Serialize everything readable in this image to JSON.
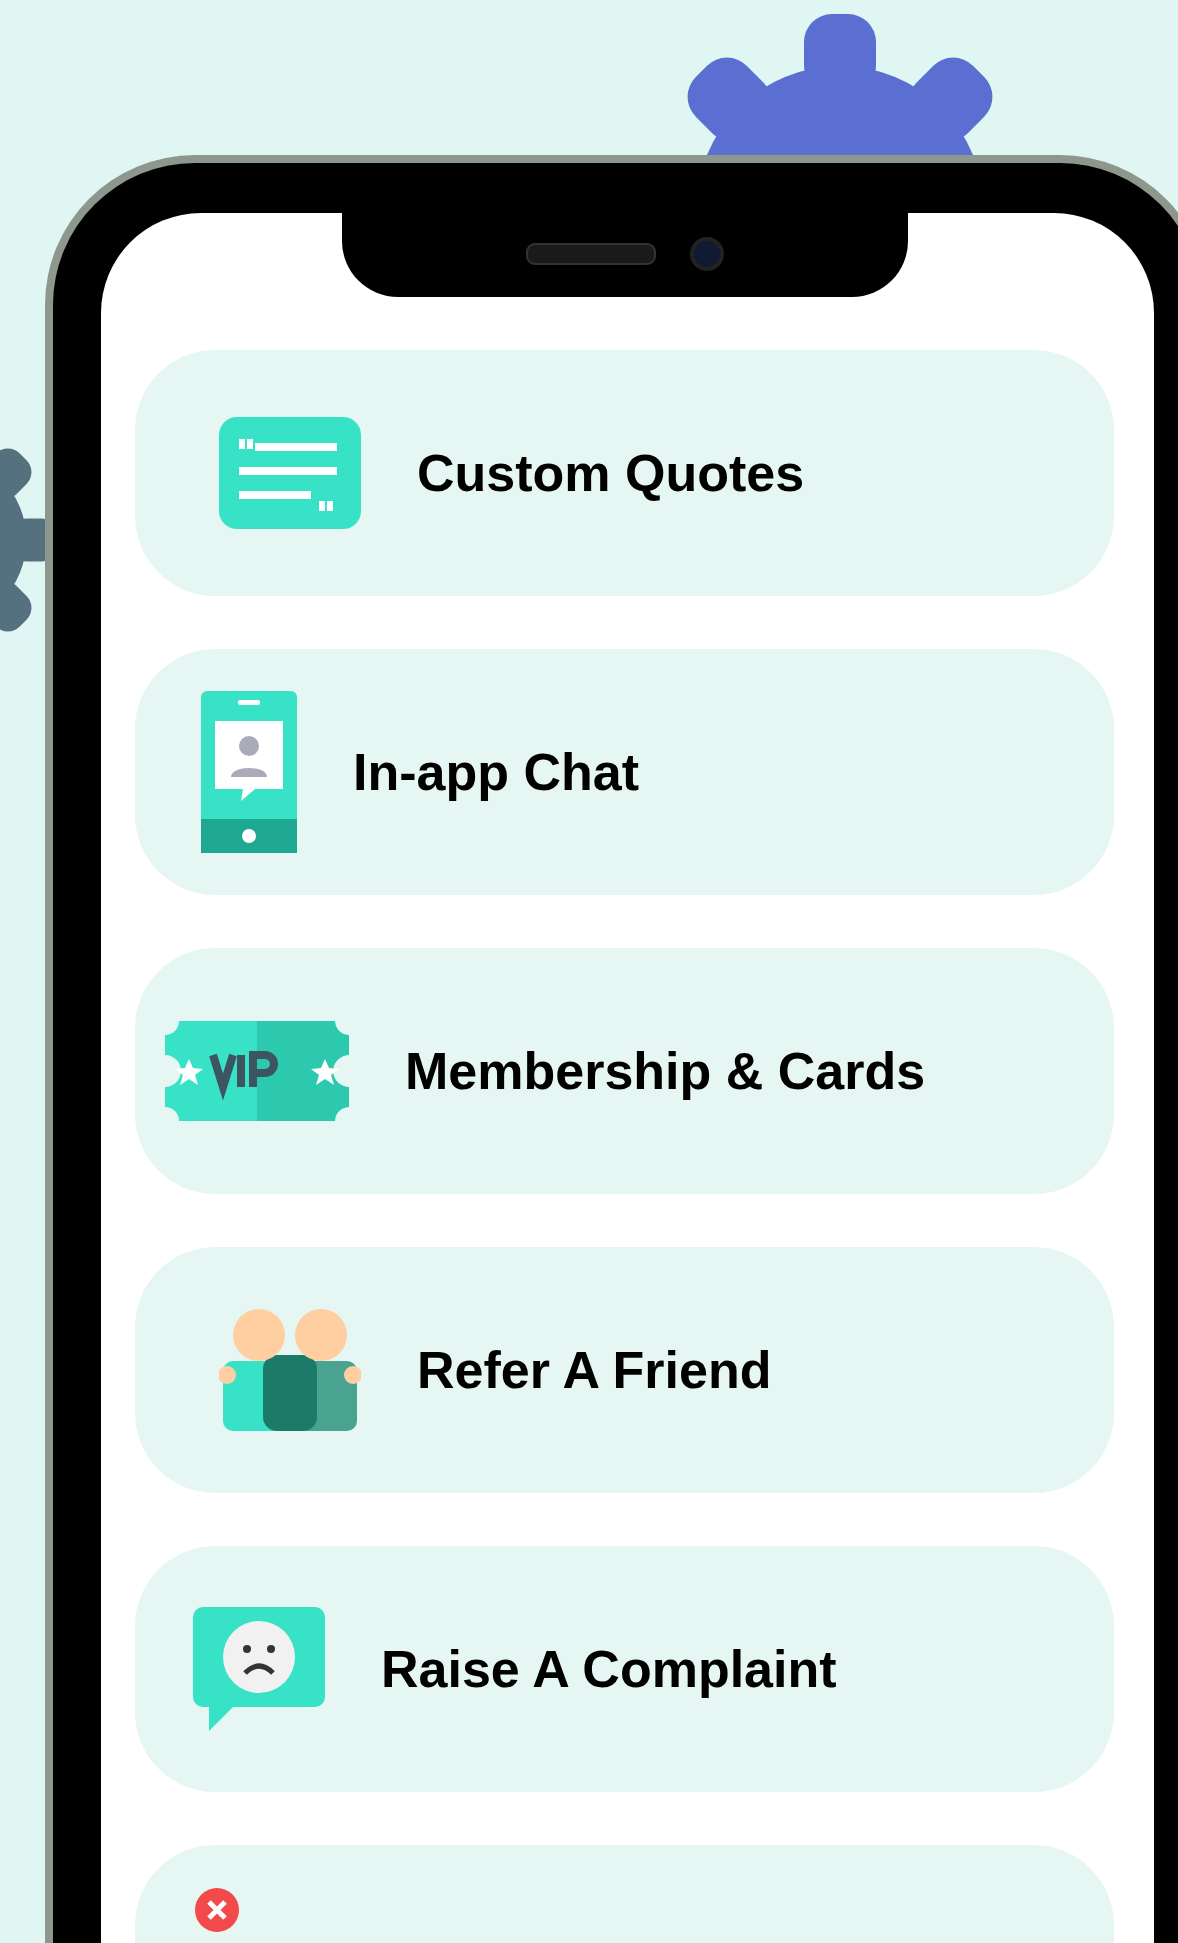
{
  "menu_items": [
    {
      "kind": "quotes",
      "label": "Custom Quotes"
    },
    {
      "kind": "chat",
      "label": "In-app Chat"
    },
    {
      "kind": "vip",
      "label": "Membership & Cards"
    },
    {
      "kind": "refer",
      "label": "Refer A Friend"
    },
    {
      "kind": "complaint",
      "label": "Raise A Complaint"
    },
    {
      "kind": "close"
    }
  ]
}
